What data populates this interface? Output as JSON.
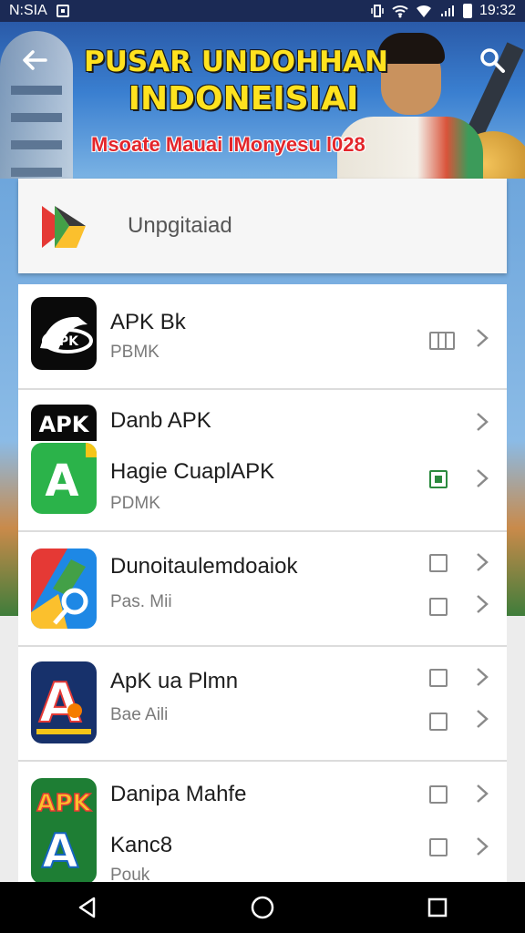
{
  "status_bar": {
    "carrier": "N:SIA",
    "time": "19:32"
  },
  "hero": {
    "title_line1": "PUSAR UNDOHHAN",
    "title_line2": "INDONEISIAI",
    "subtitle": "Msoate Mauai IMonyesu l028"
  },
  "header": {
    "label": "Unpgitaiad"
  },
  "apps": [
    {
      "title": "APK Bk",
      "subtitle": "PBMK",
      "icon_text": "APK"
    },
    {
      "title": "Danb APK",
      "subtitle": "",
      "icon_text": "APK"
    },
    {
      "title": "Hagie CuaplAPK",
      "subtitle": "PDMK",
      "icon_text": "A"
    },
    {
      "title": "Dunoitaulemdoaiok",
      "subtitle": "Pas. Mii",
      "icon_text": ""
    },
    {
      "title": "ApK ua Plmn",
      "subtitle": "Bae Aili",
      "icon_text": "A"
    },
    {
      "title": "Danipa Mahfe",
      "subtitle": "Kanc8",
      "icon_text": "APK"
    },
    {
      "title": "",
      "subtitle": "Pouk",
      "icon_text": "A"
    }
  ],
  "colors": {
    "status_bar": "#1b2a55",
    "hero_title": "#ffe21f",
    "hero_subtitle": "#e3262b",
    "checkbox_active": "#2b8a3e"
  }
}
